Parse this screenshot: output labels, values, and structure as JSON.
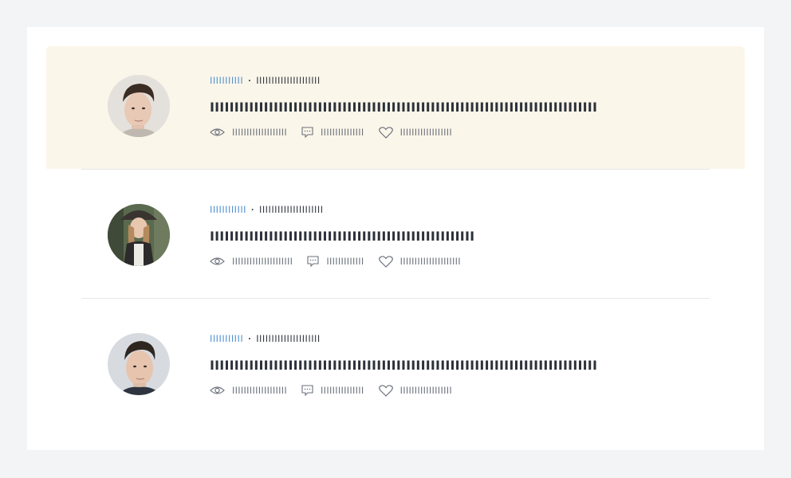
{
  "articles": [
    {
      "author": "IIIIIIIIIII",
      "separator": "·",
      "date": "IIIIIIIIIIIIIIIIIIIII",
      "title": "IIIIIIIIIIIIIIIIIIIIIIIIIIIIIIIIIIIIIIIIIIIIIIIIIIIIIIIIIIIIIIIIIIIIIIIIIIIIIII",
      "views": "IIIIIIIIIIIIIIIIIII",
      "comments": "IIIIIIIIIIIIIII",
      "likes": "IIIIIIIIIIIIIIIIII",
      "highlighted": true
    },
    {
      "author": "IIIIIIIIIIII",
      "separator": "·",
      "date": "IIIIIIIIIIIIIIIIIIIII",
      "title": "IIIIIIIIIIIIIIIIIIIIIIIIIIIIIIIIIIIIIIIIIIIIIIIIIIIIII",
      "views": "IIIIIIIIIIIIIIIIIIIII",
      "comments": "IIIIIIIIIIIII",
      "likes": "IIIIIIIIIIIIIIIIIIIII",
      "highlighted": false
    },
    {
      "author": "IIIIIIIIIII",
      "separator": "·",
      "date": "IIIIIIIIIIIIIIIIIIIII",
      "title": "IIIIIIIIIIIIIIIIIIIIIIIIIIIIIIIIIIIIIIIIIIIIIIIIIIIIIIIIIIIIIIIIIIIIIIIIIIIIIII",
      "views": "IIIIIIIIIIIIIIIIIII",
      "comments": "IIIIIIIIIIIIIII",
      "likes": "IIIIIIIIIIIIIIIIII",
      "highlighted": false
    }
  ],
  "icons": {
    "views": "eye-icon",
    "comments": "comment-icon",
    "likes": "heart-icon"
  },
  "colors": {
    "page_bg": "#f3f4f6",
    "highlight_bg": "#fbf6ea",
    "author": "#4f90cf",
    "title": "#2c313a",
    "stats": "#6b717b"
  }
}
